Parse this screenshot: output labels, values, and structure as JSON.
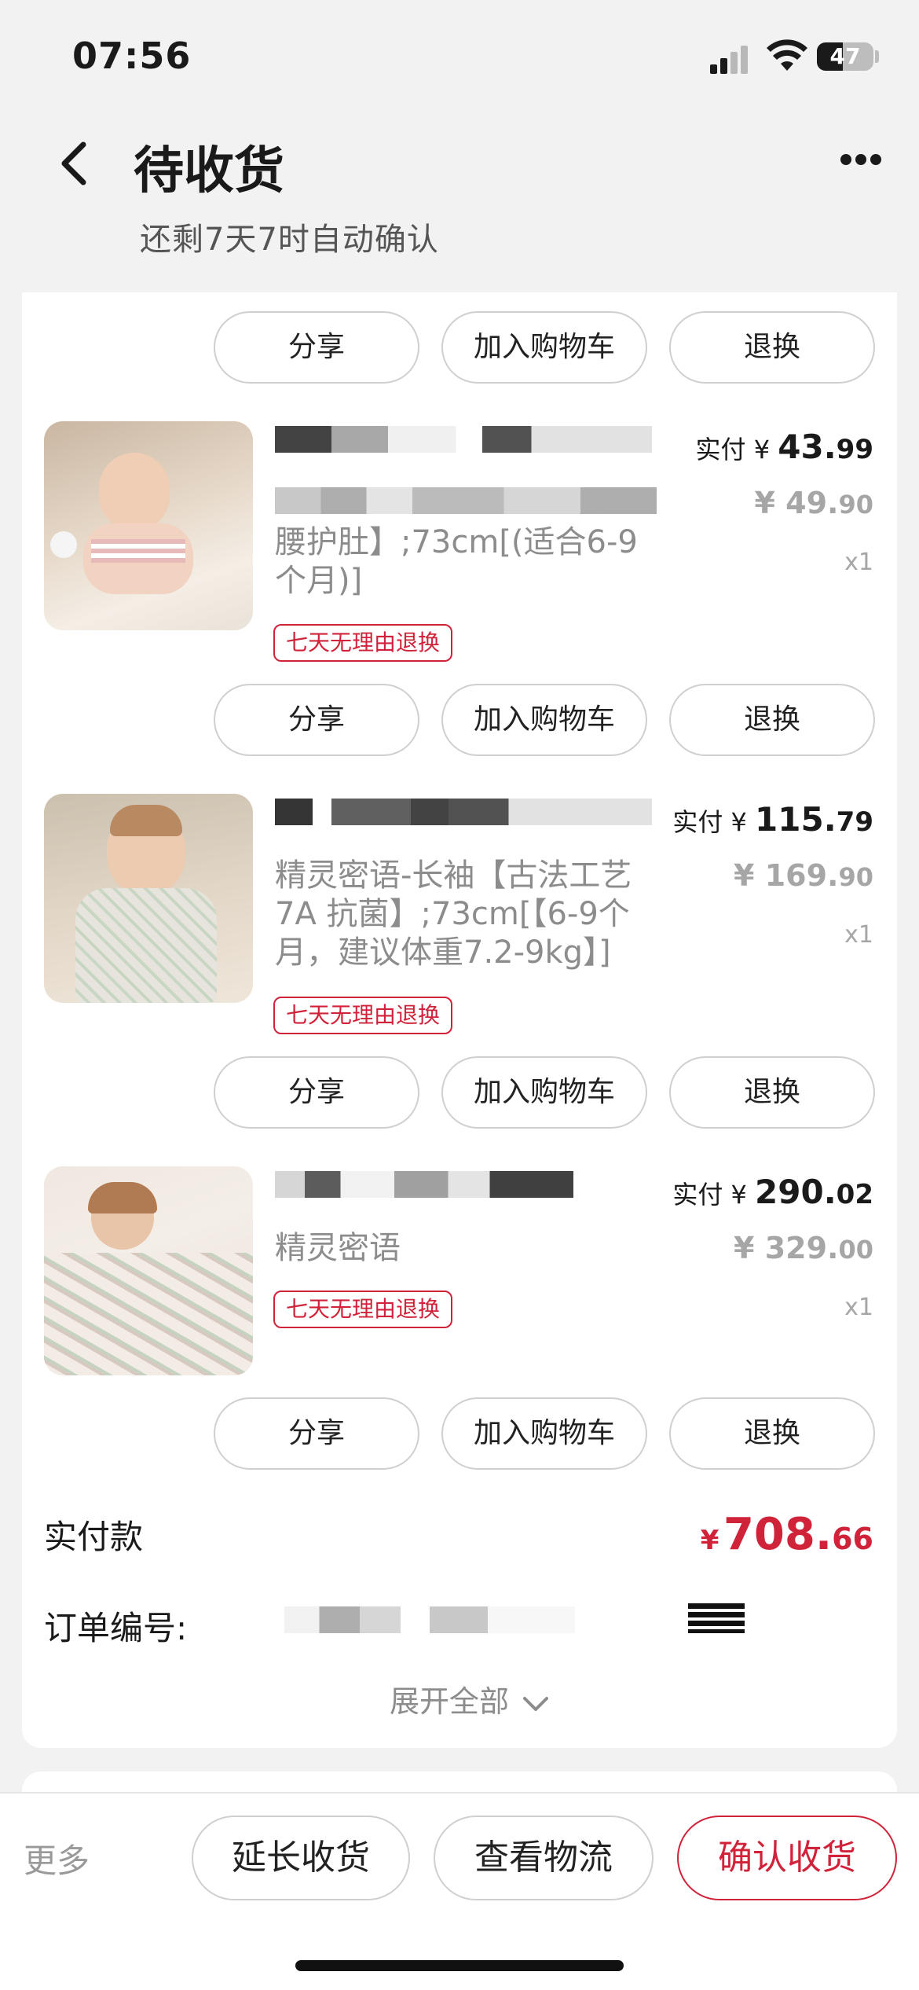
{
  "status_bar": {
    "time": "07:56",
    "battery": "47"
  },
  "header": {
    "title": "待收货",
    "subtitle": "还剩7天7时自动确认"
  },
  "actions": {
    "share": "分享",
    "add_cart": "加入购物车",
    "return": "退换"
  },
  "products": [
    {
      "spec_lines": [
        "腰护肚】;73cm[(适合6-9",
        "个月)]"
      ],
      "badge": "七天无理由退换",
      "paid_label": "实付",
      "currency": "¥",
      "paid_int": "43.",
      "paid_dec": "99",
      "orig_int": "¥ 49.",
      "orig_dec": "90",
      "qty": "x1"
    },
    {
      "spec_lines": [
        "精灵密语-长袖【古法工艺",
        "7A 抗菌】;73cm[【6-9个",
        "月，建议体重7.2-9kg】]"
      ],
      "badge": "七天无理由退换",
      "paid_label": "实付",
      "currency": "¥",
      "paid_int": "115.",
      "paid_dec": "79",
      "orig_int": "¥ 169.",
      "orig_dec": "90",
      "qty": "x1"
    },
    {
      "spec_lines": [
        "精灵密语"
      ],
      "badge": "七天无理由退换",
      "paid_label": "实付",
      "currency": "¥",
      "paid_int": "290.",
      "paid_dec": "02",
      "orig_int": "¥ 329.",
      "orig_dec": "00",
      "qty": "x1"
    }
  ],
  "summary": {
    "total_label": "实付款",
    "total_currency": "¥",
    "total_int": "708.",
    "total_dec": "66",
    "order_label": "订单编号:",
    "expand": "展开全部"
  },
  "bottom_bar": {
    "more": "更多",
    "extend": "延长收货",
    "logistics": "查看物流",
    "confirm": "确认收货"
  },
  "colors": {
    "accent": "#d0233a",
    "background": "#f2f2f2"
  }
}
